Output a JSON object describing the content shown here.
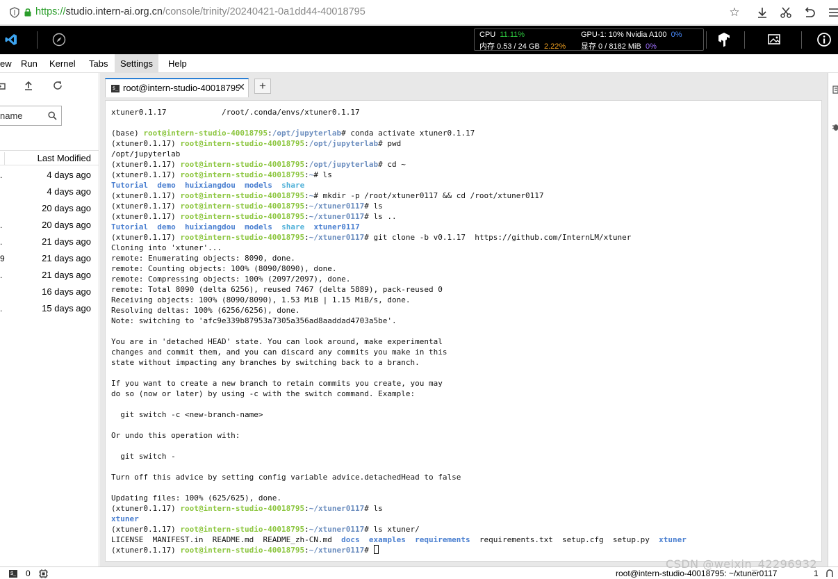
{
  "browser": {
    "url_scheme": "https://",
    "url_host": "studio.intern-ai.org.cn",
    "url_path": "/console/trinity/20240421-0a1dd44-40018795"
  },
  "monitor": {
    "cpu_label": "CPU",
    "cpu_value": "11.11%",
    "mem_label": "内存 0.53 / 24 GB",
    "mem_value": "2.22%",
    "gpu_label": "GPU-1: 10% Nvidia A100",
    "gpu_value": "0%",
    "vram_label": "显存 0 / 8182 MiB",
    "vram_value": "0%"
  },
  "menu": {
    "view": "ew",
    "run": "Run",
    "kernel": "Kernel",
    "tabs": "Tabs",
    "settings": "Settings",
    "help": "Help"
  },
  "filebrowser": {
    "filter_placeholder": "name",
    "column_last_modified": "Last Modified",
    "rows": [
      {
        "prefix": ".",
        "modified": "4 days ago"
      },
      {
        "prefix": "",
        "modified": "4 days ago"
      },
      {
        "prefix": "",
        "modified": "20 days ago"
      },
      {
        "prefix": ".",
        "modified": "20 days ago"
      },
      {
        "prefix": ".",
        "modified": "21 days ago"
      },
      {
        "prefix": "9",
        "modified": "21 days ago"
      },
      {
        "prefix": ".",
        "modified": "21 days ago"
      },
      {
        "prefix": "",
        "modified": "16 days ago"
      },
      {
        "prefix": ".",
        "modified": "15 days ago"
      }
    ]
  },
  "tab": {
    "label": "root@intern-studio-40018795:",
    "close": "✕",
    "add": "+"
  },
  "terminal": {
    "lines": [
      [
        [
          "t",
          "xtuner0.1.17            /root/.conda/envs/xtuner0.1.17"
        ]
      ],
      [
        [
          "t",
          ""
        ]
      ],
      [
        [
          "t",
          "(base) "
        ],
        [
          "pr",
          "root@intern-studio-40018795"
        ],
        [
          "t",
          ":"
        ],
        [
          "pa",
          "/opt/jupyterlab"
        ],
        [
          "t",
          "# conda activate xtuner0.1.17"
        ]
      ],
      [
        [
          "t",
          "(xtuner0.1.17) "
        ],
        [
          "pr",
          "root@intern-studio-40018795"
        ],
        [
          "t",
          ":"
        ],
        [
          "pa",
          "/opt/jupyterlab"
        ],
        [
          "t",
          "# pwd"
        ]
      ],
      [
        [
          "t",
          "/opt/jupyterlab"
        ]
      ],
      [
        [
          "t",
          "(xtuner0.1.17) "
        ],
        [
          "pr",
          "root@intern-studio-40018795"
        ],
        [
          "t",
          ":"
        ],
        [
          "pa",
          "/opt/jupyterlab"
        ],
        [
          "t",
          "# cd ~"
        ]
      ],
      [
        [
          "t",
          "(xtuner0.1.17) "
        ],
        [
          "pr",
          "root@intern-studio-40018795"
        ],
        [
          "t",
          ":"
        ],
        [
          "pa",
          "~"
        ],
        [
          "t",
          "# ls"
        ]
      ],
      [
        [
          "dir",
          "Tutorial"
        ],
        [
          "t",
          "  "
        ],
        [
          "dir",
          "demo"
        ],
        [
          "t",
          "  "
        ],
        [
          "dir",
          "huixiangdou"
        ],
        [
          "t",
          "  "
        ],
        [
          "dir",
          "models"
        ],
        [
          "t",
          "  "
        ],
        [
          "dirl",
          "share"
        ]
      ],
      [
        [
          "t",
          "(xtuner0.1.17) "
        ],
        [
          "pr",
          "root@intern-studio-40018795"
        ],
        [
          "t",
          ":"
        ],
        [
          "pa",
          "~"
        ],
        [
          "t",
          "# mkdir -p /root/xtuner0117 && cd /root/xtuner0117"
        ]
      ],
      [
        [
          "t",
          "(xtuner0.1.17) "
        ],
        [
          "pr",
          "root@intern-studio-40018795"
        ],
        [
          "t",
          ":"
        ],
        [
          "pa",
          "~/xtuner0117"
        ],
        [
          "t",
          "# ls"
        ]
      ],
      [
        [
          "t",
          "(xtuner0.1.17) "
        ],
        [
          "pr",
          "root@intern-studio-40018795"
        ],
        [
          "t",
          ":"
        ],
        [
          "pa",
          "~/xtuner0117"
        ],
        [
          "t",
          "# ls .."
        ]
      ],
      [
        [
          "dir",
          "Tutorial"
        ],
        [
          "t",
          "  "
        ],
        [
          "dir",
          "demo"
        ],
        [
          "t",
          "  "
        ],
        [
          "dir",
          "huixiangdou"
        ],
        [
          "t",
          "  "
        ],
        [
          "dir",
          "models"
        ],
        [
          "t",
          "  "
        ],
        [
          "dirl",
          "share"
        ],
        [
          "t",
          "  "
        ],
        [
          "dir",
          "xtuner0117"
        ]
      ],
      [
        [
          "t",
          "(xtuner0.1.17) "
        ],
        [
          "pr",
          "root@intern-studio-40018795"
        ],
        [
          "t",
          ":"
        ],
        [
          "pa",
          "~/xtuner0117"
        ],
        [
          "t",
          "# git clone -b v0.1.17  https://github.com/InternLM/xtuner"
        ]
      ],
      [
        [
          "t",
          "Cloning into 'xtuner'..."
        ]
      ],
      [
        [
          "t",
          "remote: Enumerating objects: 8090, done."
        ]
      ],
      [
        [
          "t",
          "remote: Counting objects: 100% (8090/8090), done."
        ]
      ],
      [
        [
          "t",
          "remote: Compressing objects: 100% (2097/2097), done."
        ]
      ],
      [
        [
          "t",
          "remote: Total 8090 (delta 6256), reused 7467 (delta 5889), pack-reused 0"
        ]
      ],
      [
        [
          "t",
          "Receiving objects: 100% (8090/8090), 1.53 MiB | 1.15 MiB/s, done."
        ]
      ],
      [
        [
          "t",
          "Resolving deltas: 100% (6256/6256), done."
        ]
      ],
      [
        [
          "t",
          "Note: switching to 'afc9e339b87953a7305a356ad8aaddad4703a5be'."
        ]
      ],
      [
        [
          "t",
          ""
        ]
      ],
      [
        [
          "t",
          "You are in 'detached HEAD' state. You can look around, make experimental"
        ]
      ],
      [
        [
          "t",
          "changes and commit them, and you can discard any commits you make in this"
        ]
      ],
      [
        [
          "t",
          "state without impacting any branches by switching back to a branch."
        ]
      ],
      [
        [
          "t",
          ""
        ]
      ],
      [
        [
          "t",
          "If you want to create a new branch to retain commits you create, you may"
        ]
      ],
      [
        [
          "t",
          "do so (now or later) by using -c with the switch command. Example:"
        ]
      ],
      [
        [
          "t",
          ""
        ]
      ],
      [
        [
          "t",
          "  git switch -c <new-branch-name>"
        ]
      ],
      [
        [
          "t",
          ""
        ]
      ],
      [
        [
          "t",
          "Or undo this operation with:"
        ]
      ],
      [
        [
          "t",
          ""
        ]
      ],
      [
        [
          "t",
          "  git switch -"
        ]
      ],
      [
        [
          "t",
          ""
        ]
      ],
      [
        [
          "t",
          "Turn off this advice by setting config variable advice.detachedHead to false"
        ]
      ],
      [
        [
          "t",
          ""
        ]
      ],
      [
        [
          "t",
          "Updating files: 100% (625/625), done."
        ]
      ],
      [
        [
          "t",
          "(xtuner0.1.17) "
        ],
        [
          "pr",
          "root@intern-studio-40018795"
        ],
        [
          "t",
          ":"
        ],
        [
          "pa",
          "~/xtuner0117"
        ],
        [
          "t",
          "# ls"
        ]
      ],
      [
        [
          "dir",
          "xtuner"
        ]
      ],
      [
        [
          "t",
          "(xtuner0.1.17) "
        ],
        [
          "pr",
          "root@intern-studio-40018795"
        ],
        [
          "t",
          ":"
        ],
        [
          "pa",
          "~/xtuner0117"
        ],
        [
          "t",
          "# ls xtuner/"
        ]
      ],
      [
        [
          "t",
          "LICENSE  MANIFEST.in  README.md  README_zh-CN.md  "
        ],
        [
          "dir",
          "docs"
        ],
        [
          "t",
          "  "
        ],
        [
          "dir",
          "examples"
        ],
        [
          "t",
          "  "
        ],
        [
          "dir",
          "requirements"
        ],
        [
          "t",
          "  requirements.txt  setup.cfg  setup.py  "
        ],
        [
          "dir",
          "xtuner"
        ]
      ],
      [
        [
          "t",
          "(xtuner0.1.17) "
        ],
        [
          "pr",
          "root@intern-studio-40018795"
        ],
        [
          "t",
          ":"
        ],
        [
          "pa",
          "~/xtuner0117"
        ],
        [
          "t",
          "# "
        ],
        [
          "cursor",
          ""
        ]
      ]
    ]
  },
  "status": {
    "terminal_count": "0",
    "path": "root@intern-studio-40018795: ~/xtuner0117",
    "count": "1"
  },
  "watermark": "CSDN @weixin_42296932"
}
